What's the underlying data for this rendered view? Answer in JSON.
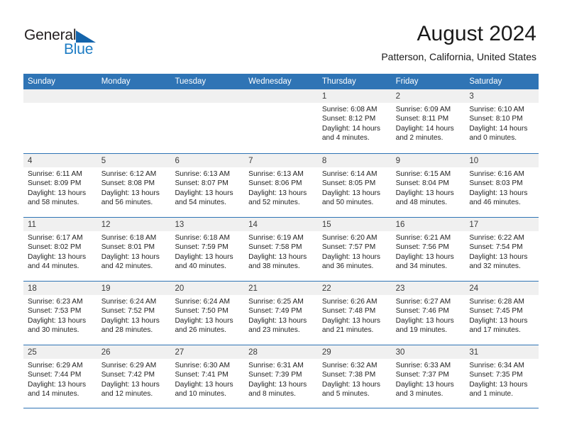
{
  "brand": {
    "word_one": "General",
    "word_two": "Blue",
    "triangle_icon": "triangle-icon",
    "color_dark": "#231f20",
    "color_blue": "#1d7cc4"
  },
  "header": {
    "title": "August 2024",
    "subtitle": "Patterson, California, United States"
  },
  "theme": {
    "header_blue": "#2f74b5",
    "day_band_gray": "#f0f0f0",
    "text_dark": "#232323"
  },
  "weekdays": [
    "Sunday",
    "Monday",
    "Tuesday",
    "Wednesday",
    "Thursday",
    "Friday",
    "Saturday"
  ],
  "weeks": [
    [
      {
        "day": "",
        "lines": []
      },
      {
        "day": "",
        "lines": []
      },
      {
        "day": "",
        "lines": []
      },
      {
        "day": "",
        "lines": []
      },
      {
        "day": "1",
        "lines": [
          "Sunrise: 6:08 AM",
          "Sunset: 8:12 PM",
          "Daylight: 14 hours",
          "and 4 minutes."
        ]
      },
      {
        "day": "2",
        "lines": [
          "Sunrise: 6:09 AM",
          "Sunset: 8:11 PM",
          "Daylight: 14 hours",
          "and 2 minutes."
        ]
      },
      {
        "day": "3",
        "lines": [
          "Sunrise: 6:10 AM",
          "Sunset: 8:10 PM",
          "Daylight: 14 hours",
          "and 0 minutes."
        ]
      }
    ],
    [
      {
        "day": "4",
        "lines": [
          "Sunrise: 6:11 AM",
          "Sunset: 8:09 PM",
          "Daylight: 13 hours",
          "and 58 minutes."
        ]
      },
      {
        "day": "5",
        "lines": [
          "Sunrise: 6:12 AM",
          "Sunset: 8:08 PM",
          "Daylight: 13 hours",
          "and 56 minutes."
        ]
      },
      {
        "day": "6",
        "lines": [
          "Sunrise: 6:13 AM",
          "Sunset: 8:07 PM",
          "Daylight: 13 hours",
          "and 54 minutes."
        ]
      },
      {
        "day": "7",
        "lines": [
          "Sunrise: 6:13 AM",
          "Sunset: 8:06 PM",
          "Daylight: 13 hours",
          "and 52 minutes."
        ]
      },
      {
        "day": "8",
        "lines": [
          "Sunrise: 6:14 AM",
          "Sunset: 8:05 PM",
          "Daylight: 13 hours",
          "and 50 minutes."
        ]
      },
      {
        "day": "9",
        "lines": [
          "Sunrise: 6:15 AM",
          "Sunset: 8:04 PM",
          "Daylight: 13 hours",
          "and 48 minutes."
        ]
      },
      {
        "day": "10",
        "lines": [
          "Sunrise: 6:16 AM",
          "Sunset: 8:03 PM",
          "Daylight: 13 hours",
          "and 46 minutes."
        ]
      }
    ],
    [
      {
        "day": "11",
        "lines": [
          "Sunrise: 6:17 AM",
          "Sunset: 8:02 PM",
          "Daylight: 13 hours",
          "and 44 minutes."
        ]
      },
      {
        "day": "12",
        "lines": [
          "Sunrise: 6:18 AM",
          "Sunset: 8:01 PM",
          "Daylight: 13 hours",
          "and 42 minutes."
        ]
      },
      {
        "day": "13",
        "lines": [
          "Sunrise: 6:18 AM",
          "Sunset: 7:59 PM",
          "Daylight: 13 hours",
          "and 40 minutes."
        ]
      },
      {
        "day": "14",
        "lines": [
          "Sunrise: 6:19 AM",
          "Sunset: 7:58 PM",
          "Daylight: 13 hours",
          "and 38 minutes."
        ]
      },
      {
        "day": "15",
        "lines": [
          "Sunrise: 6:20 AM",
          "Sunset: 7:57 PM",
          "Daylight: 13 hours",
          "and 36 minutes."
        ]
      },
      {
        "day": "16",
        "lines": [
          "Sunrise: 6:21 AM",
          "Sunset: 7:56 PM",
          "Daylight: 13 hours",
          "and 34 minutes."
        ]
      },
      {
        "day": "17",
        "lines": [
          "Sunrise: 6:22 AM",
          "Sunset: 7:54 PM",
          "Daylight: 13 hours",
          "and 32 minutes."
        ]
      }
    ],
    [
      {
        "day": "18",
        "lines": [
          "Sunrise: 6:23 AM",
          "Sunset: 7:53 PM",
          "Daylight: 13 hours",
          "and 30 minutes."
        ]
      },
      {
        "day": "19",
        "lines": [
          "Sunrise: 6:24 AM",
          "Sunset: 7:52 PM",
          "Daylight: 13 hours",
          "and 28 minutes."
        ]
      },
      {
        "day": "20",
        "lines": [
          "Sunrise: 6:24 AM",
          "Sunset: 7:50 PM",
          "Daylight: 13 hours",
          "and 26 minutes."
        ]
      },
      {
        "day": "21",
        "lines": [
          "Sunrise: 6:25 AM",
          "Sunset: 7:49 PM",
          "Daylight: 13 hours",
          "and 23 minutes."
        ]
      },
      {
        "day": "22",
        "lines": [
          "Sunrise: 6:26 AM",
          "Sunset: 7:48 PM",
          "Daylight: 13 hours",
          "and 21 minutes."
        ]
      },
      {
        "day": "23",
        "lines": [
          "Sunrise: 6:27 AM",
          "Sunset: 7:46 PM",
          "Daylight: 13 hours",
          "and 19 minutes."
        ]
      },
      {
        "day": "24",
        "lines": [
          "Sunrise: 6:28 AM",
          "Sunset: 7:45 PM",
          "Daylight: 13 hours",
          "and 17 minutes."
        ]
      }
    ],
    [
      {
        "day": "25",
        "lines": [
          "Sunrise: 6:29 AM",
          "Sunset: 7:44 PM",
          "Daylight: 13 hours",
          "and 14 minutes."
        ]
      },
      {
        "day": "26",
        "lines": [
          "Sunrise: 6:29 AM",
          "Sunset: 7:42 PM",
          "Daylight: 13 hours",
          "and 12 minutes."
        ]
      },
      {
        "day": "27",
        "lines": [
          "Sunrise: 6:30 AM",
          "Sunset: 7:41 PM",
          "Daylight: 13 hours",
          "and 10 minutes."
        ]
      },
      {
        "day": "28",
        "lines": [
          "Sunrise: 6:31 AM",
          "Sunset: 7:39 PM",
          "Daylight: 13 hours",
          "and 8 minutes."
        ]
      },
      {
        "day": "29",
        "lines": [
          "Sunrise: 6:32 AM",
          "Sunset: 7:38 PM",
          "Daylight: 13 hours",
          "and 5 minutes."
        ]
      },
      {
        "day": "30",
        "lines": [
          "Sunrise: 6:33 AM",
          "Sunset: 7:37 PM",
          "Daylight: 13 hours",
          "and 3 minutes."
        ]
      },
      {
        "day": "31",
        "lines": [
          "Sunrise: 6:34 AM",
          "Sunset: 7:35 PM",
          "Daylight: 13 hours",
          "and 1 minute."
        ]
      }
    ]
  ]
}
